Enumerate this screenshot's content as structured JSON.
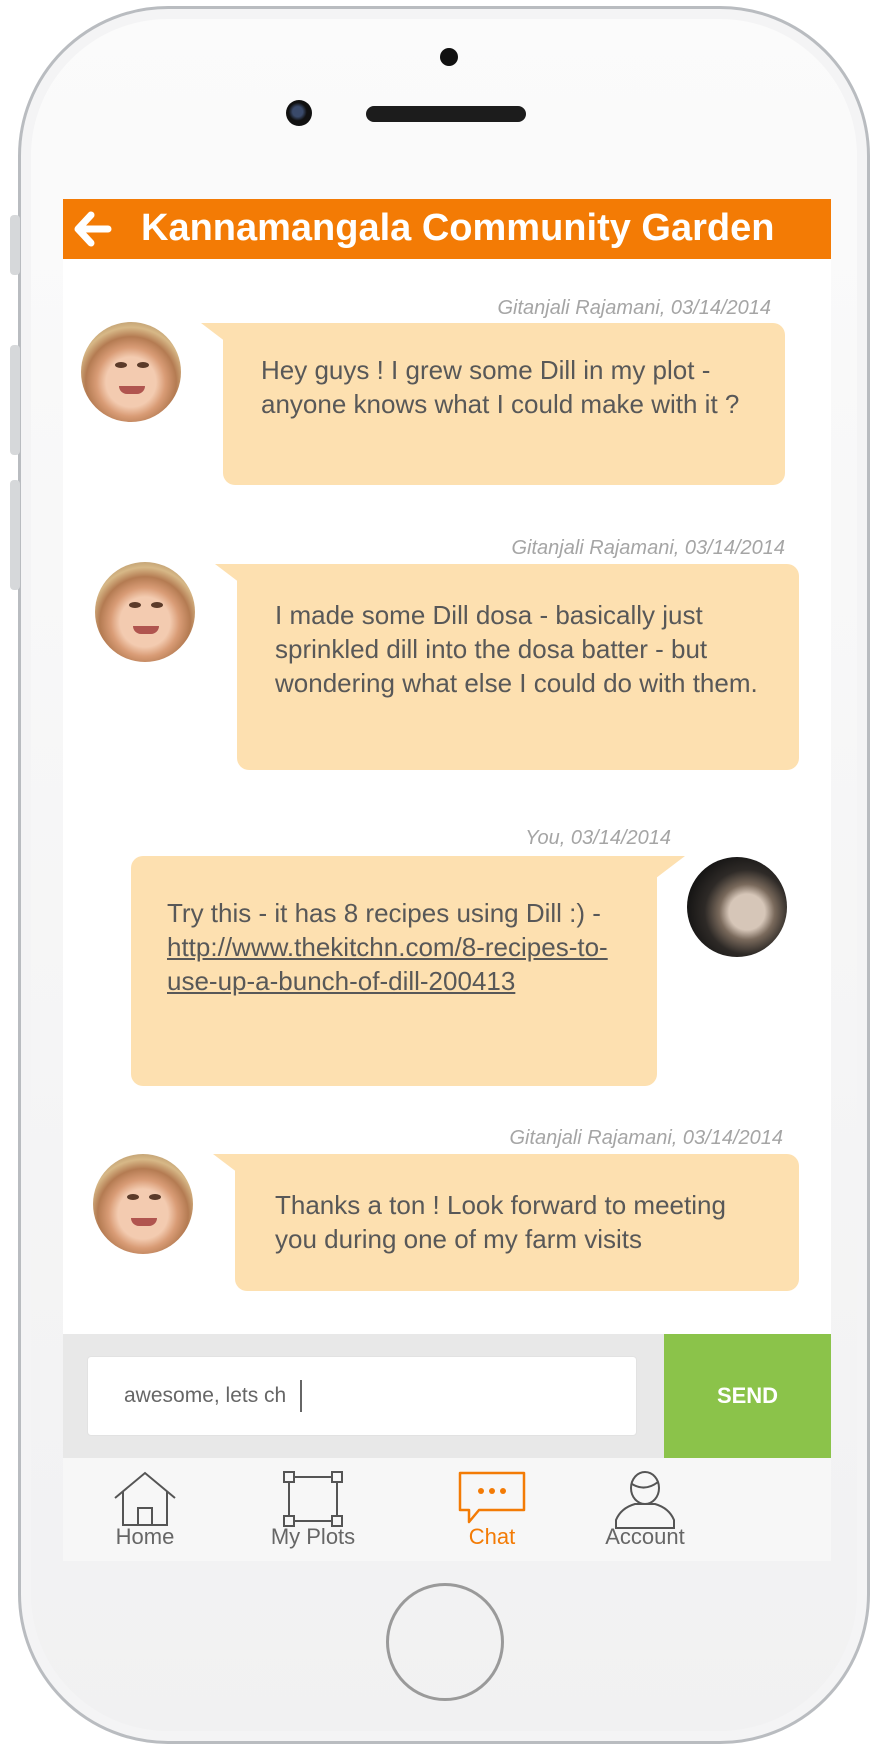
{
  "header": {
    "title": "Kannamangala Community Garden"
  },
  "messages": [
    {
      "author_date": "Gitanjali Rajamani, 03/14/2014",
      "text": "Hey guys ! I grew some Dill in my plot - anyone knows what I could make with it ?"
    },
    {
      "author_date": "Gitanjali Rajamani, 03/14/2014",
      "text": "I made some Dill dosa - basically just sprinkled dill into the dosa batter - but wondering what else I could do with them."
    },
    {
      "author_date": "You, 03/14/2014",
      "text_prefix": "Try this - it has 8 recipes using Dill :) - ",
      "link": "http://www.thekitchn.com/8-recipes-to-use-up-a-bunch-of-dill-200413"
    },
    {
      "author_date": "Gitanjali Rajamani, 03/14/2014",
      "text": "Thanks a ton !  Look forward to meeting you during one of my farm visits"
    }
  ],
  "composer": {
    "value": "awesome, lets ch",
    "send_label": "SEND"
  },
  "tabs": [
    {
      "label": "Home",
      "icon": "home-icon"
    },
    {
      "label": "My Plots",
      "icon": "plots-icon"
    },
    {
      "label": "Chat",
      "icon": "chat-icon",
      "active": true
    },
    {
      "label": "Account",
      "icon": "account-icon"
    }
  ],
  "colors": {
    "accent": "#f37b05",
    "bubble": "#fde0b0",
    "send": "#8bc34a"
  }
}
